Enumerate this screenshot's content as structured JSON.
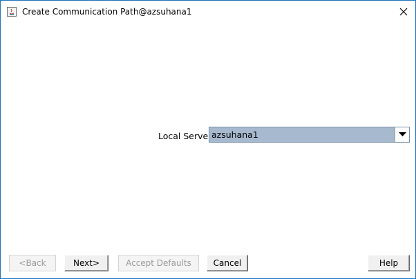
{
  "window": {
    "title": "Create Communication Path@azsuhana1",
    "app_icon": "java-app-icon",
    "close_icon": "close-icon"
  },
  "form": {
    "local_server_label": "Local Server",
    "local_server_value": "azsuhana1",
    "dropdown_icon": "chevron-down-icon"
  },
  "buttons": {
    "back": "<Back",
    "next": "Next>",
    "accept_defaults": "Accept Defaults",
    "cancel": "Cancel",
    "help": "Help"
  },
  "colors": {
    "window_border": "#1e72b8",
    "combo_selected": "#a7b9cf"
  }
}
